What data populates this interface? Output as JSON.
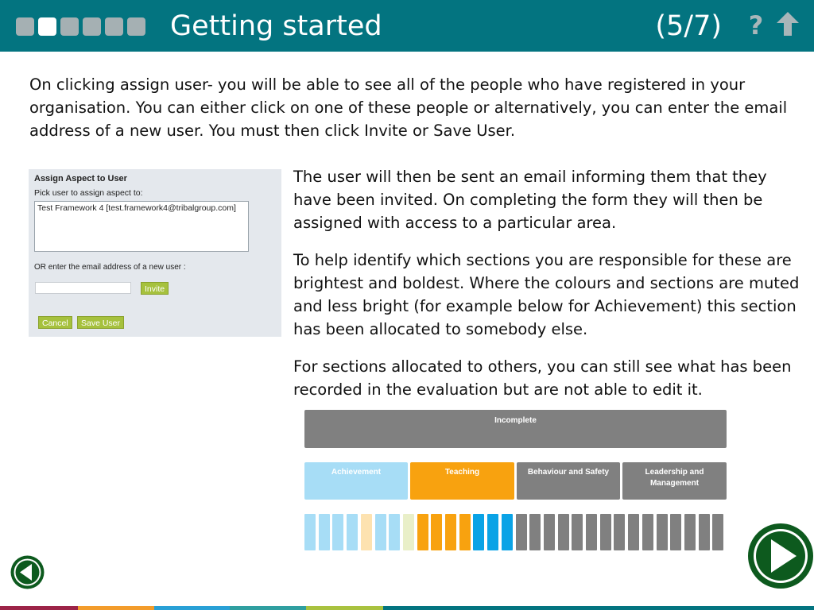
{
  "header": {
    "title": "Getting started",
    "counter": "(5/7)",
    "help_icon": "?",
    "progress": {
      "total": 6,
      "current": 2
    },
    "icons": [
      "help-icon",
      "home-arrow-icon"
    ],
    "colors": {
      "bar": "#037480",
      "dot": "#a5b0b3",
      "dot_active": "#ffffff"
    }
  },
  "content": {
    "intro": "On clicking assign user- you will be able to see all of the people who have registered in your organisation. You can either click on one of these people or alternatively, you can enter the email address of a new user. You must then click Invite or Save User.",
    "p1": "The user will then be sent an email informing them that they have been invited. On completing the form they will then be assigned with access to a particular area.",
    "p2": "To help identify which sections you are responsible for these are brightest and boldest. Where the colours and sections are muted and less bright (for example below for Achievement) this section has been allocated to somebody else.",
    "p3": "For sections allocated to others, you can still see what has been recorded in the evaluation but are not able to edit it."
  },
  "dialog": {
    "title": "Assign Aspect to User",
    "pick_label": "Pick user to assign aspect to:",
    "list_item": "Test Framework 4 [test.framework4@tribalgroup.com]",
    "or_label": "OR enter the email address of a new user :",
    "email_value": "",
    "invite_label": "Invite",
    "cancel_label": "Cancel",
    "save_label": "Save User",
    "colors": {
      "background": "#e4e8ed",
      "button": "#a6c13d"
    }
  },
  "diagram": {
    "incomplete_label": "Incomplete",
    "sections": [
      {
        "label": "Achievement",
        "color": "#a7ddf6"
      },
      {
        "label": "Teaching",
        "color": "#f8a20f"
      },
      {
        "label": "Behaviour and Safety",
        "color": "#808080"
      },
      {
        "label": "Leadership and Management",
        "color": "#808080"
      }
    ],
    "bar_colors": [
      "#a7ddf6",
      "#a7ddf6",
      "#a7ddf6",
      "#a7ddf6",
      "#fde2b0",
      "#a7ddf6",
      "#a7ddf6",
      "#e9efc8",
      "#f8a20f",
      "#f8a20f",
      "#f8a20f",
      "#f8a20f",
      "#0aa3e6",
      "#0aa3e6",
      "#0aa3e6",
      "#808080",
      "#808080",
      "#808080",
      "#808080",
      "#808080",
      "#808080",
      "#808080",
      "#808080",
      "#808080",
      "#808080",
      "#808080",
      "#808080",
      "#808080",
      "#808080",
      "#808080"
    ]
  },
  "navigation": {
    "back_icon": "back-arrow-icon",
    "next_icon": "next-play-icon",
    "color": "#0d5a1e"
  },
  "footer_colors": [
    "#9c2448",
    "#f39c2b",
    "#29a0d6",
    "#2f9fa0",
    "#a9c23f",
    "#037480"
  ]
}
